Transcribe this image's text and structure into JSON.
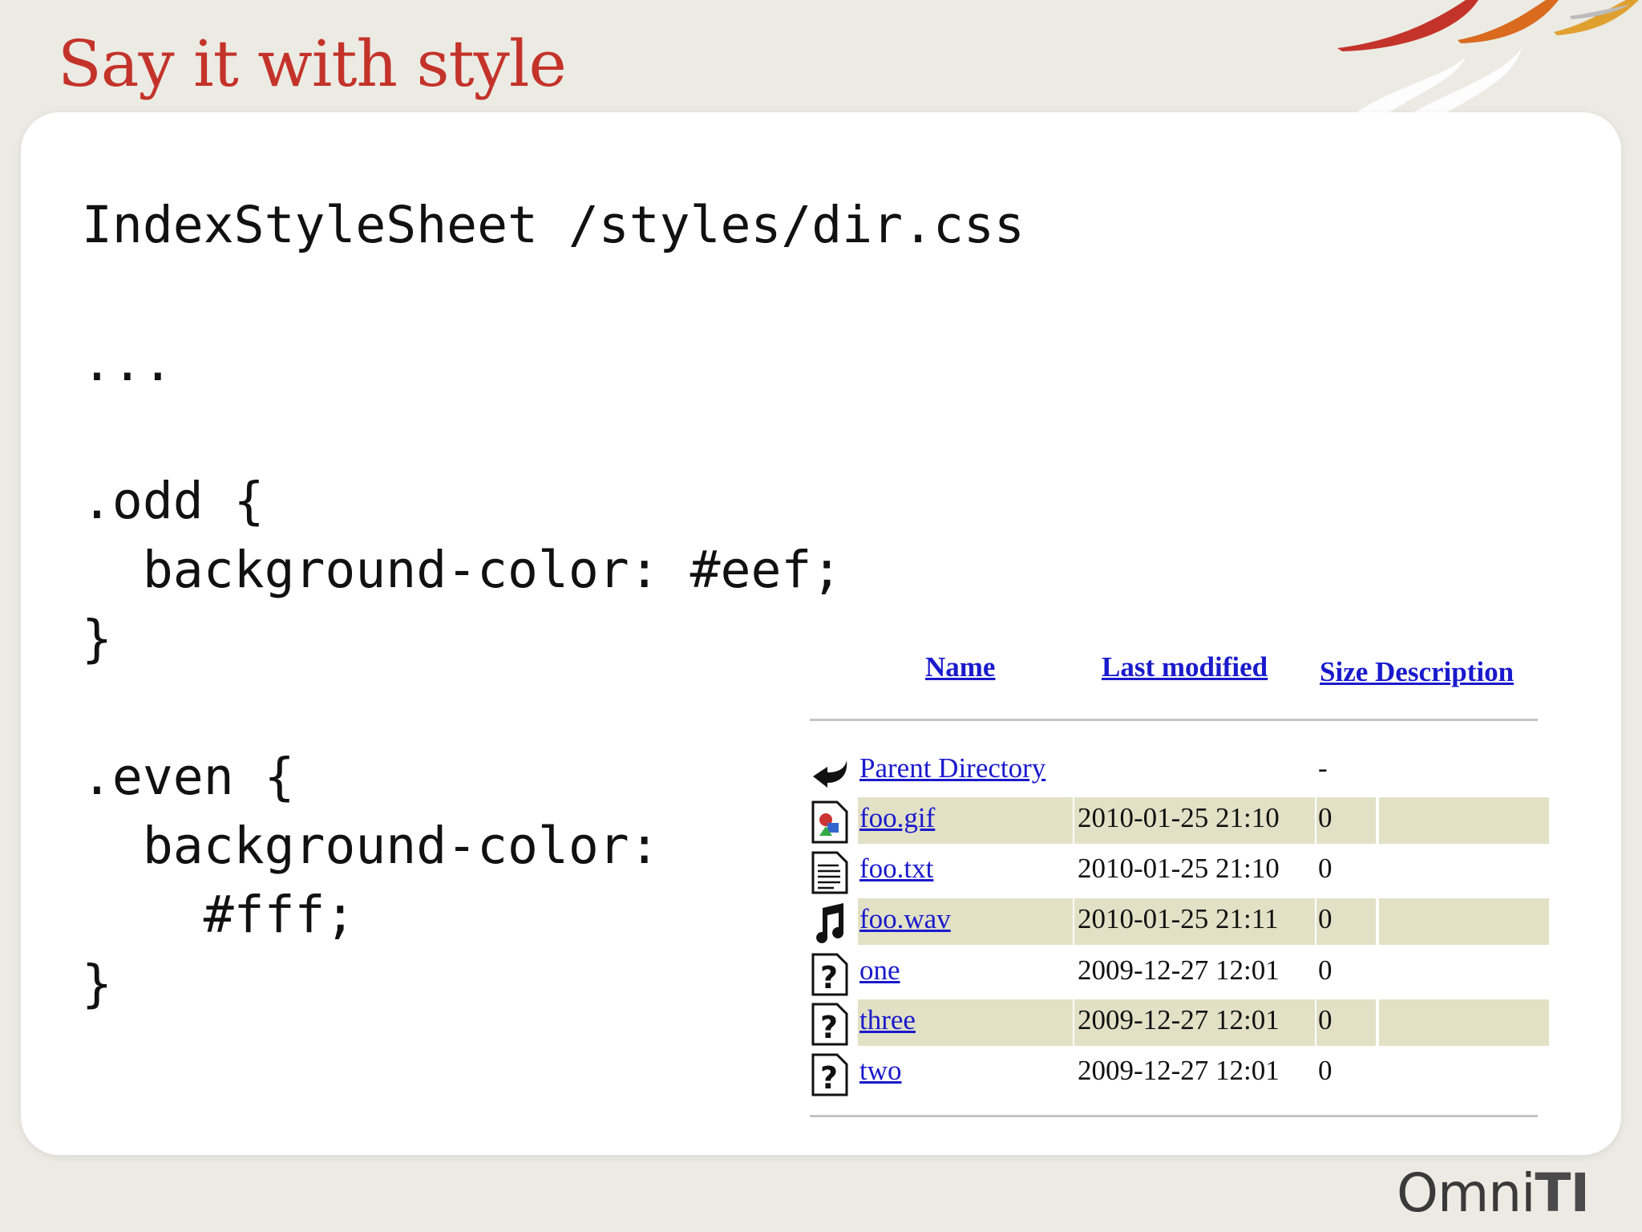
{
  "slide": {
    "title": "Say it with style"
  },
  "code": {
    "text": "IndexStyleSheet /styles/dir.css\n\n...\n\n.odd {\n  background-color: #eef;\n}\n\n.even {\n  background-color:\n    #fff;\n}"
  },
  "listing": {
    "headers": {
      "name": "Name",
      "last_modified": "Last modified",
      "size_description": "Size Description"
    },
    "rows": [
      {
        "icon": "back-icon",
        "name": "Parent Directory",
        "modified": "",
        "size": "-",
        "shaded": false
      },
      {
        "icon": "image-file-icon",
        "name": "foo.gif",
        "modified": "2010-01-25 21:10",
        "size": "0",
        "shaded": true
      },
      {
        "icon": "text-file-icon",
        "name": "foo.txt",
        "modified": "2010-01-25 21:10",
        "size": "0",
        "shaded": false
      },
      {
        "icon": "sound-file-icon",
        "name": "foo.wav",
        "modified": "2010-01-25 21:11",
        "size": "0",
        "shaded": true
      },
      {
        "icon": "unknown-file-icon",
        "name": "one",
        "modified": "2009-12-27 12:01",
        "size": "0",
        "shaded": false
      },
      {
        "icon": "unknown-file-icon",
        "name": "three",
        "modified": "2009-12-27 12:01",
        "size": "0",
        "shaded": true
      },
      {
        "icon": "unknown-file-icon",
        "name": "two",
        "modified": "2009-12-27 12:01",
        "size": "0",
        "shaded": false
      }
    ]
  },
  "branding": {
    "logo_prefix": "Omni",
    "logo_suffix": "TI"
  },
  "colors": {
    "title": "#c4332a",
    "link": "#1a1acc",
    "row_shade": "#e2e1c6",
    "background": "#ebebe4"
  }
}
